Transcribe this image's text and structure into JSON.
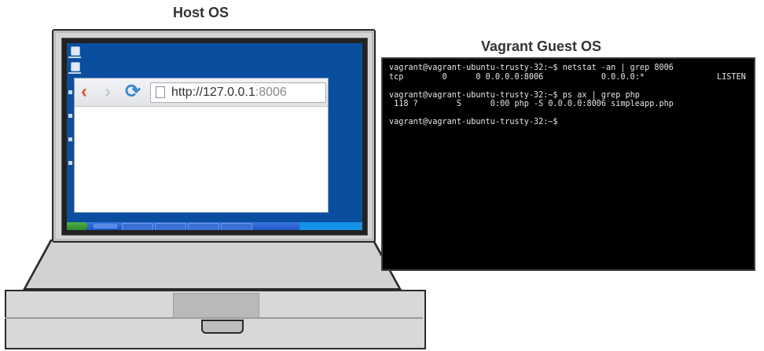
{
  "host_label": "Host OS",
  "guest_label": "Vagrant Guest OS",
  "browser": {
    "url_host": "http://127.0.0.1",
    "url_port": ":8006"
  },
  "terminal": {
    "lines": [
      "vagrant@vagrant-ubuntu-trusty-32:~$ netstat -an | grep 8006",
      "tcp        0      0 0.0.0.0:8006            0.0.0.0:*               LISTEN",
      "",
      "vagrant@vagrant-ubuntu-trusty-32:~$ ps ax | grep php",
      " 118 ?        S      0:00 php -S 0.0.0.0:8006 simpleapp.php",
      "",
      "vagrant@vagrant-ubuntu-trusty-32:~$"
    ]
  },
  "colors": {
    "desktop": "#0a4ea0",
    "terminal_bg": "#000000",
    "terminal_fg": "#e6e6e6",
    "back_arrow": "#d55a2b",
    "reload": "#3a86d6"
  }
}
